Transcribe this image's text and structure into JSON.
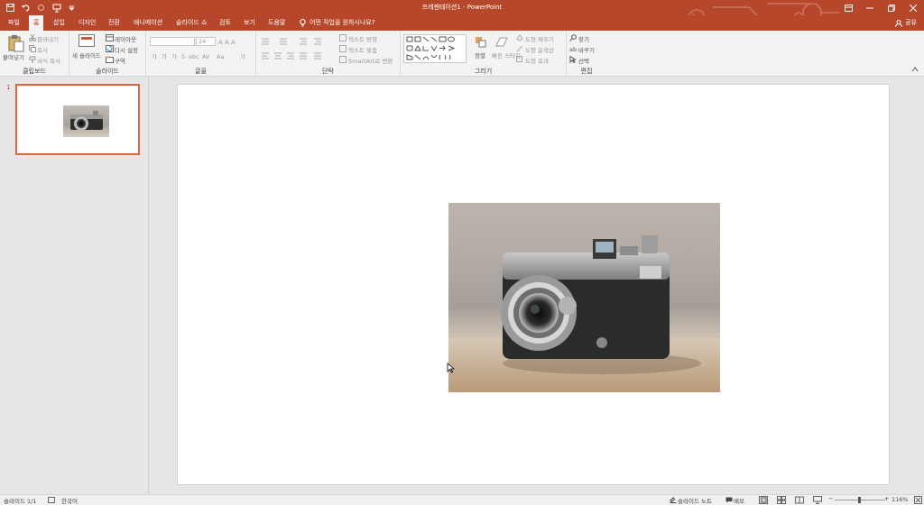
{
  "title_bar": {
    "document_title": "프레젠테이션1  -  PowerPoint",
    "accent_color": "#b7472a",
    "qat_icons": [
      "save-icon",
      "undo-icon",
      "redo-icon",
      "presenter-icon",
      "customize-icon"
    ]
  },
  "menu": {
    "tabs": [
      "파일",
      "홈",
      "삽입",
      "디자인",
      "전환",
      "애니메이션",
      "슬라이드 쇼",
      "검토",
      "보기",
      "도움말"
    ],
    "active_tab": "홈",
    "tell_me": "어떤 작업을 원하시나요?",
    "share": "공유"
  },
  "ribbon": {
    "clipboard": {
      "label": "클립보드",
      "paste": "붙여넣기",
      "cut": "잘라내기",
      "copy": "복사",
      "format_painter": "서식 복사"
    },
    "slides": {
      "label": "슬라이드",
      "new_slide": "새 슬라이드",
      "layout": "레이아웃",
      "reset": "다시 설정",
      "section": "구역"
    },
    "font": {
      "label": "글꼴",
      "font_name": "",
      "font_size": "24"
    },
    "paragraph": {
      "label": "단락",
      "text_direction": "텍스트 방향",
      "align_text": "텍스트 맞춤",
      "smartart": "SmartArt로 변환"
    },
    "drawing": {
      "label": "그리기",
      "arrange": "정렬",
      "quick_styles": "빠른 스타일",
      "shape_fill": "도형 채우기",
      "shape_outline": "도형 윤곽선",
      "shape_effects": "도형 효과"
    },
    "editing": {
      "label": "편집",
      "find": "찾기",
      "replace": "바꾸기",
      "select": "선택"
    }
  },
  "slide_pane": {
    "slide_number": "1"
  },
  "status_bar": {
    "slide_info": "슬라이드 1/1",
    "language": "한국어",
    "notes": "슬라이드 노트",
    "comments": "메모",
    "zoom": "116%"
  }
}
